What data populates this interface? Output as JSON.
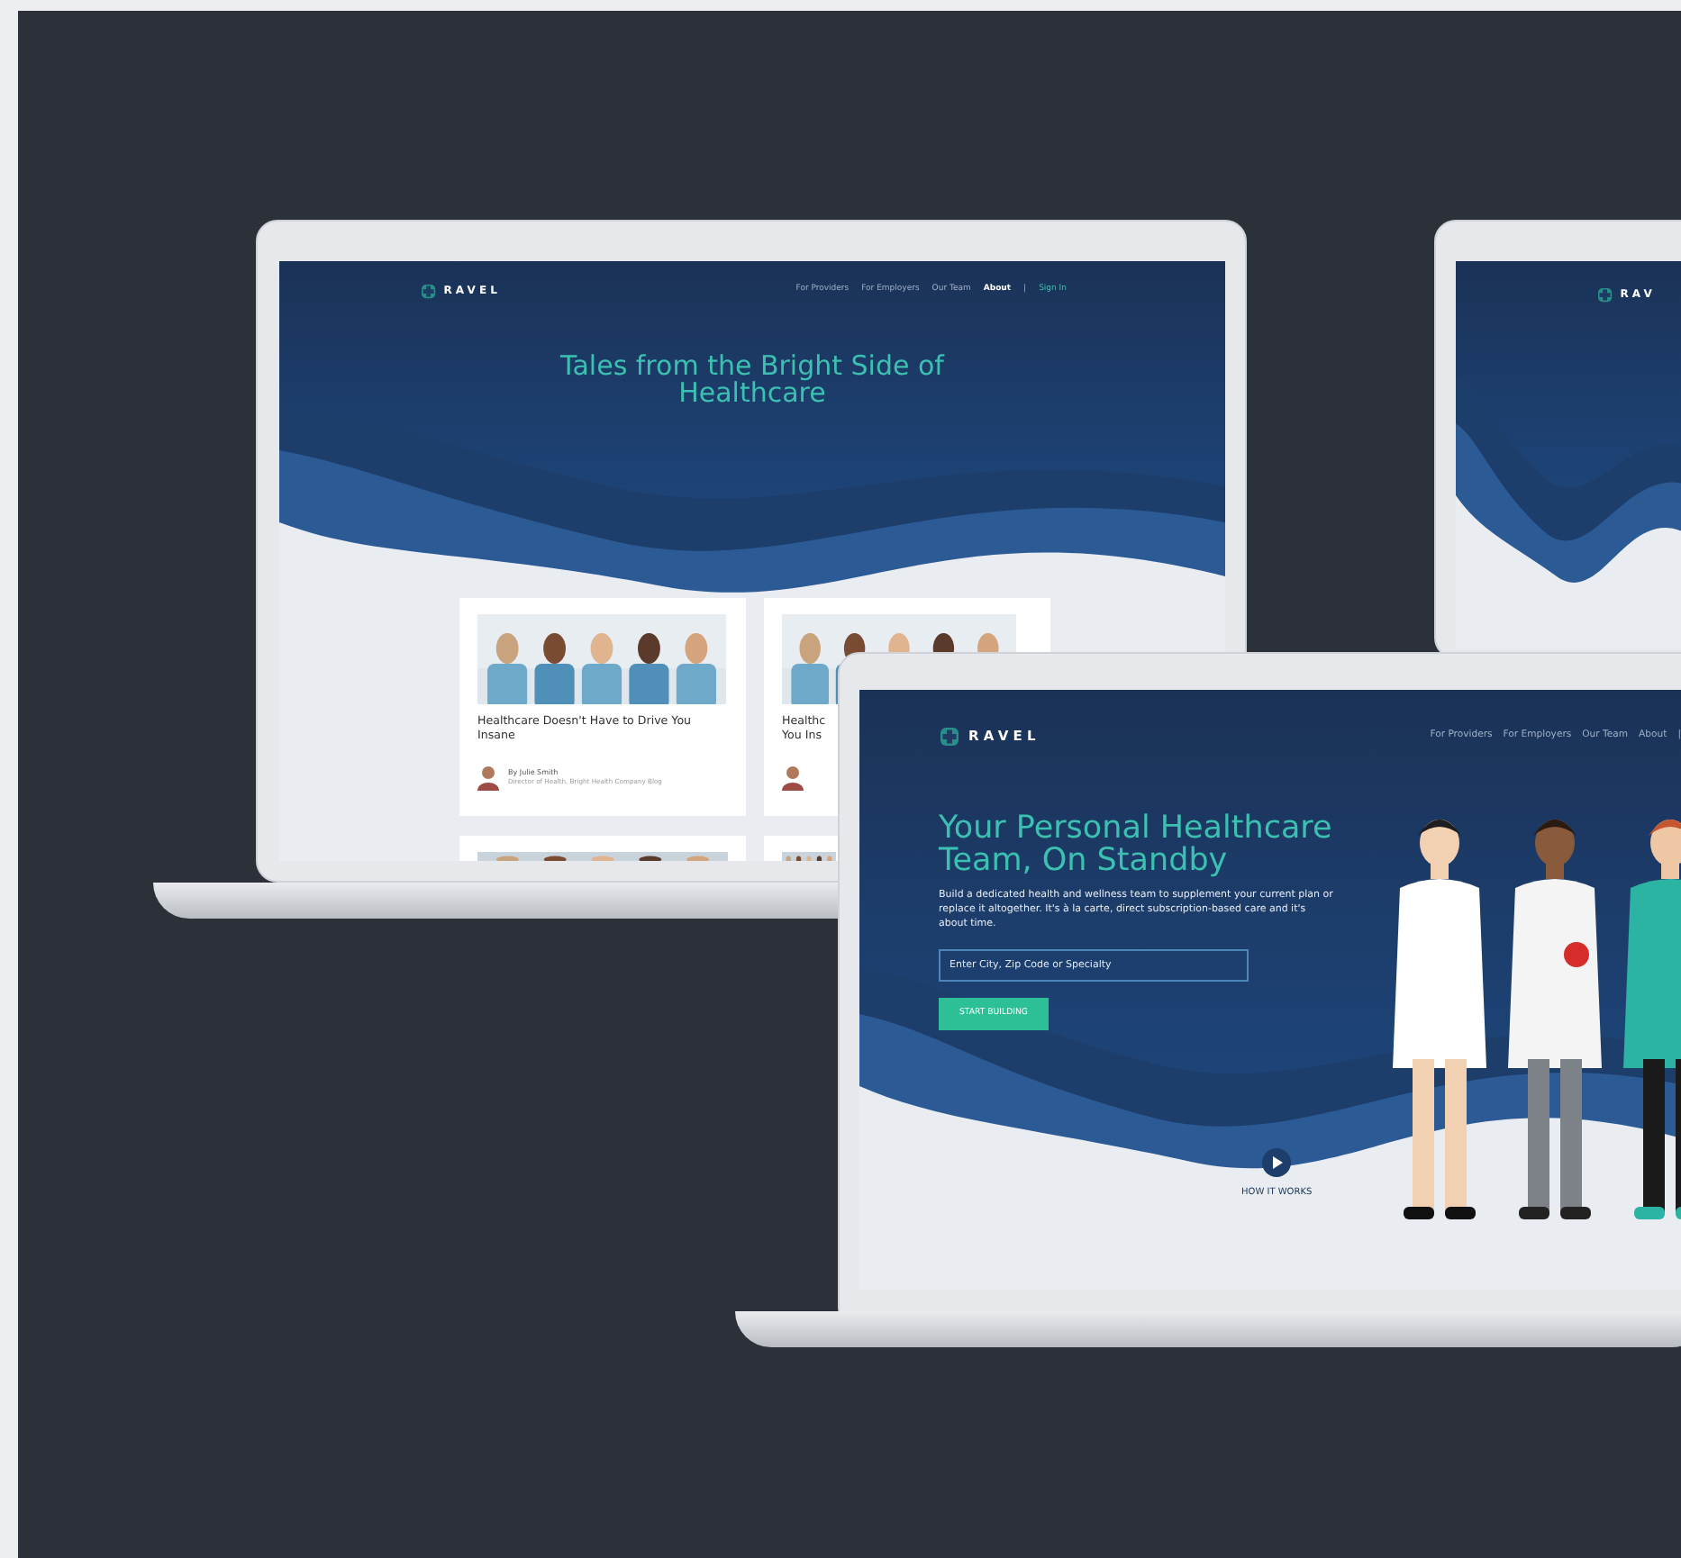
{
  "blog_screen": {
    "logo": "RAVEL",
    "nav": [
      {
        "label": "For Providers",
        "selected": false
      },
      {
        "label": "For Employers",
        "selected": false
      },
      {
        "label": "Our Team",
        "selected": false
      },
      {
        "label": "About",
        "selected": true
      }
    ],
    "separator": "|",
    "sign_in": "Sign In",
    "heading": "Tales from the Bright Side of Healthcare",
    "cards": [
      {
        "title": "Healthcare Doesn't Have to Drive You Insane",
        "author": "By Julie Smith",
        "author_role": "Director of Health, Bright Health Company Blog"
      },
      {
        "title": "Healthc You Ins"
      }
    ]
  },
  "side_screen": {
    "logo": "RAV"
  },
  "home_screen": {
    "logo": "RAVEL",
    "nav": [
      {
        "label": "For Providers",
        "selected": false
      },
      {
        "label": "For Employers",
        "selected": false
      },
      {
        "label": "Our Team",
        "selected": false
      },
      {
        "label": "About",
        "selected": false
      }
    ],
    "separator": "|",
    "heading": "Your Personal Healthcare Team, On Standby",
    "text": "Build a dedicated health and wellness team to supplement your current plan or replace it altogether. It's à la carte, direct subscription-based care and it's about time.",
    "search": {
      "placeholder": "Enter City, Zip Code or Specialty"
    },
    "button": "START BUILDING",
    "how_it_works": "HOW IT WORKS"
  }
}
